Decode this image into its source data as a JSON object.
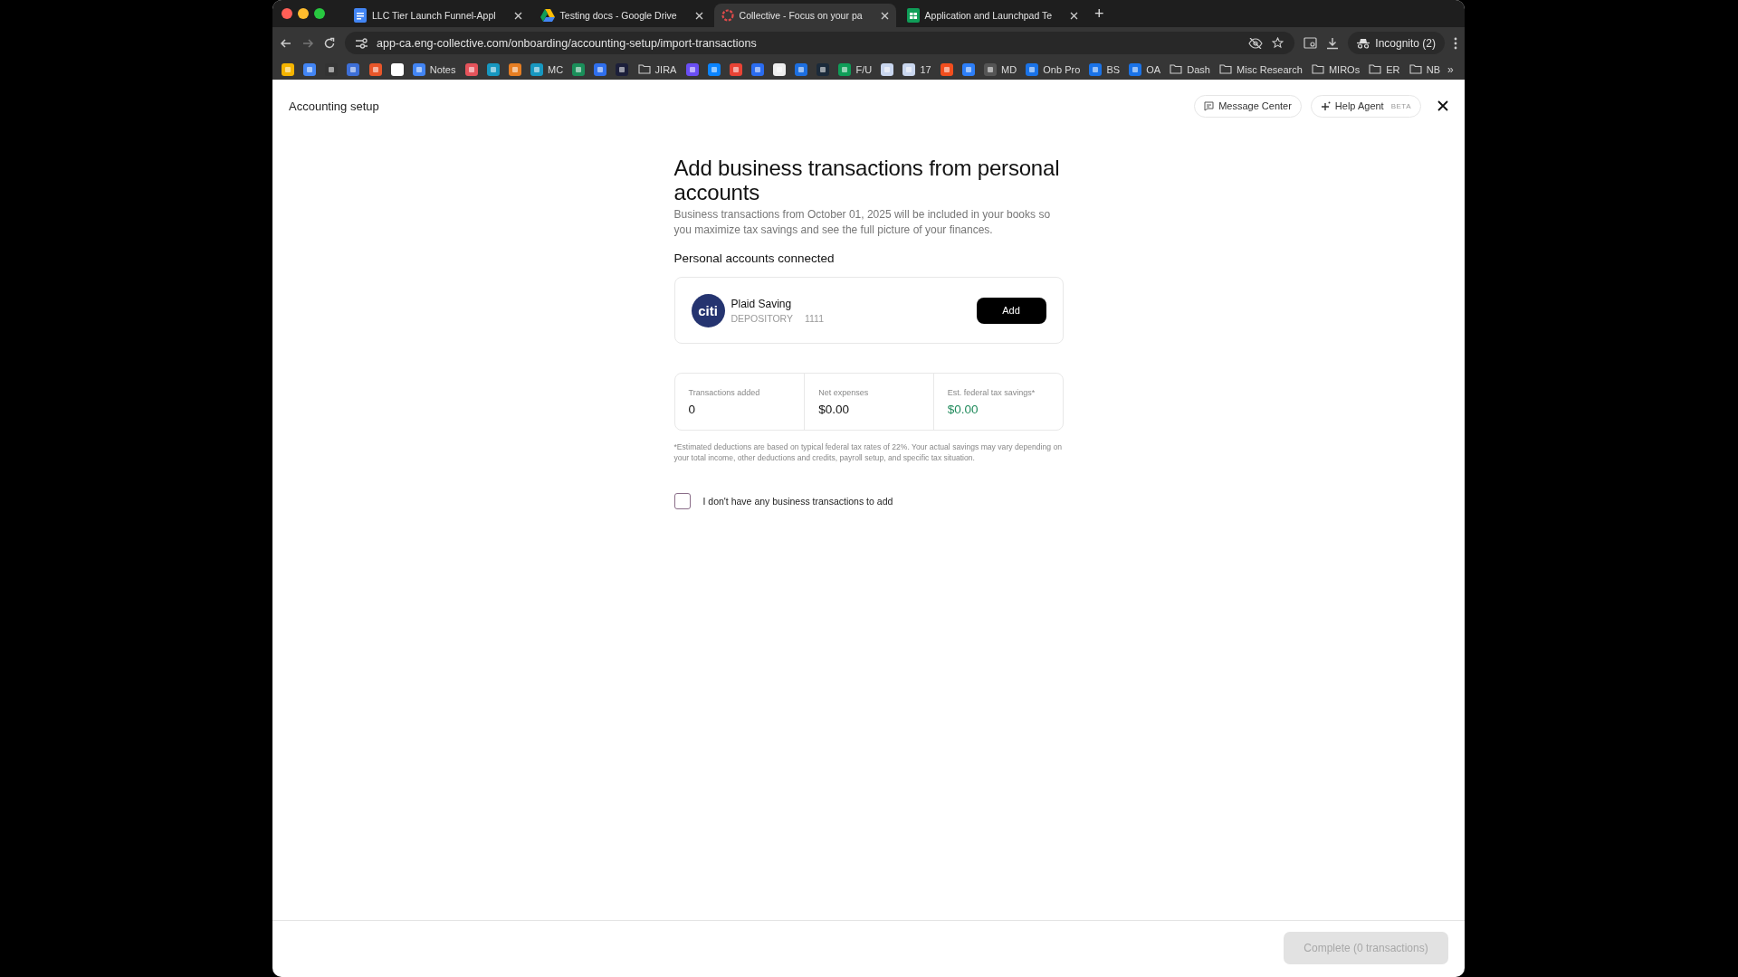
{
  "browser": {
    "tabs": [
      {
        "title": "LLC Tier Launch Funnel-Appl",
        "kind": "docs",
        "selected": false
      },
      {
        "title": "Testing docs - Google Drive",
        "kind": "drive",
        "selected": false
      },
      {
        "title": "Collective - Focus on your pa",
        "kind": "collective",
        "selected": true
      },
      {
        "title": "Application and Launchpad Te",
        "kind": "sheets",
        "selected": false
      }
    ],
    "new_tab": "+",
    "address": "app-ca.eng-collective.com/onboarding/accounting-setup/import-transactions",
    "profile": "Incognito (2)",
    "bookmarks": [
      {
        "kind": "site"
      },
      {
        "kind": "site"
      },
      {
        "kind": "site"
      },
      {
        "kind": "site"
      },
      {
        "kind": "site"
      },
      {
        "kind": "site"
      },
      {
        "kind": "site",
        "label": "Notes"
      },
      {
        "kind": "site"
      },
      {
        "kind": "site"
      },
      {
        "kind": "site"
      },
      {
        "kind": "site",
        "label": "MC"
      },
      {
        "kind": "site"
      },
      {
        "kind": "site"
      },
      {
        "kind": "site"
      },
      {
        "kind": "folder",
        "label": "JIRA"
      },
      {
        "kind": "site"
      },
      {
        "kind": "site"
      },
      {
        "kind": "site"
      },
      {
        "kind": "site"
      },
      {
        "kind": "site"
      },
      {
        "kind": "site"
      },
      {
        "kind": "site"
      },
      {
        "kind": "site",
        "label": "F/U"
      },
      {
        "kind": "site"
      },
      {
        "kind": "site",
        "label": "17"
      },
      {
        "kind": "site"
      },
      {
        "kind": "site"
      },
      {
        "kind": "site",
        "label": "MD"
      },
      {
        "kind": "site",
        "label": "Onb Pro"
      },
      {
        "kind": "site",
        "label": "BS"
      },
      {
        "kind": "site",
        "label": "OA"
      },
      {
        "kind": "folder",
        "label": "Dash"
      },
      {
        "kind": "folder",
        "label": "Misc Research"
      },
      {
        "kind": "folder",
        "label": "MIROs"
      },
      {
        "kind": "folder",
        "label": "ER"
      },
      {
        "kind": "folder",
        "label": "NB"
      }
    ],
    "more_bookmarks": "»"
  },
  "page": {
    "title": "Accounting setup",
    "header_buttons": [
      {
        "kind": "messages",
        "label": "Message Center"
      },
      {
        "kind": "agent",
        "label": "Help Agent",
        "badge": "BETA"
      }
    ],
    "heading": "Add business transactions from personal accounts",
    "subtitle": "Business transactions from October 01, 2025 will be included in your books so you maximize tax savings and see the full picture of your finances.",
    "section_title": "Personal accounts connected",
    "accounts": [
      {
        "logo": "citi",
        "name": "Plaid Saving",
        "type": "DEPOSITORY",
        "mask": "1111",
        "action": "Add"
      }
    ],
    "stats": [
      {
        "label": "Transactions added",
        "value": "0",
        "kind": "plain"
      },
      {
        "label": "Net expenses",
        "value": "$0.00",
        "kind": "plain"
      },
      {
        "label": "Est. federal tax savings*",
        "value": "$0.00",
        "kind": "positive"
      }
    ],
    "footnote": "*Estimated deductions are based on typical federal tax rates of 22%. Your actual savings may vary depending on your total income, other deductions and credits, payroll setup, and specific tax situation.",
    "no_transactions": {
      "label": "I don't have any business transactions to add",
      "checked": false
    },
    "complete_button": {
      "label": "Complete (0 transactions)",
      "disabled": true
    }
  }
}
